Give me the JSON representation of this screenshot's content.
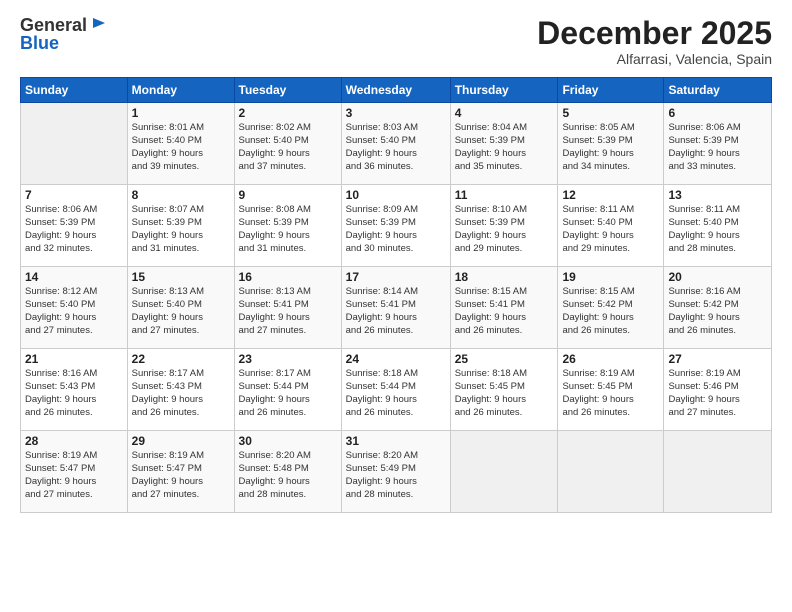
{
  "header": {
    "logo_general": "General",
    "logo_blue": "Blue",
    "month_title": "December 2025",
    "location": "Alfarrasi, Valencia, Spain"
  },
  "days_of_week": [
    "Sunday",
    "Monday",
    "Tuesday",
    "Wednesday",
    "Thursday",
    "Friday",
    "Saturday"
  ],
  "weeks": [
    [
      {
        "num": "",
        "info": ""
      },
      {
        "num": "1",
        "info": "Sunrise: 8:01 AM\nSunset: 5:40 PM\nDaylight: 9 hours\nand 39 minutes."
      },
      {
        "num": "2",
        "info": "Sunrise: 8:02 AM\nSunset: 5:40 PM\nDaylight: 9 hours\nand 37 minutes."
      },
      {
        "num": "3",
        "info": "Sunrise: 8:03 AM\nSunset: 5:40 PM\nDaylight: 9 hours\nand 36 minutes."
      },
      {
        "num": "4",
        "info": "Sunrise: 8:04 AM\nSunset: 5:39 PM\nDaylight: 9 hours\nand 35 minutes."
      },
      {
        "num": "5",
        "info": "Sunrise: 8:05 AM\nSunset: 5:39 PM\nDaylight: 9 hours\nand 34 minutes."
      },
      {
        "num": "6",
        "info": "Sunrise: 8:06 AM\nSunset: 5:39 PM\nDaylight: 9 hours\nand 33 minutes."
      }
    ],
    [
      {
        "num": "7",
        "info": "Sunrise: 8:06 AM\nSunset: 5:39 PM\nDaylight: 9 hours\nand 32 minutes."
      },
      {
        "num": "8",
        "info": "Sunrise: 8:07 AM\nSunset: 5:39 PM\nDaylight: 9 hours\nand 31 minutes."
      },
      {
        "num": "9",
        "info": "Sunrise: 8:08 AM\nSunset: 5:39 PM\nDaylight: 9 hours\nand 31 minutes."
      },
      {
        "num": "10",
        "info": "Sunrise: 8:09 AM\nSunset: 5:39 PM\nDaylight: 9 hours\nand 30 minutes."
      },
      {
        "num": "11",
        "info": "Sunrise: 8:10 AM\nSunset: 5:39 PM\nDaylight: 9 hours\nand 29 minutes."
      },
      {
        "num": "12",
        "info": "Sunrise: 8:11 AM\nSunset: 5:40 PM\nDaylight: 9 hours\nand 29 minutes."
      },
      {
        "num": "13",
        "info": "Sunrise: 8:11 AM\nSunset: 5:40 PM\nDaylight: 9 hours\nand 28 minutes."
      }
    ],
    [
      {
        "num": "14",
        "info": "Sunrise: 8:12 AM\nSunset: 5:40 PM\nDaylight: 9 hours\nand 27 minutes."
      },
      {
        "num": "15",
        "info": "Sunrise: 8:13 AM\nSunset: 5:40 PM\nDaylight: 9 hours\nand 27 minutes."
      },
      {
        "num": "16",
        "info": "Sunrise: 8:13 AM\nSunset: 5:41 PM\nDaylight: 9 hours\nand 27 minutes."
      },
      {
        "num": "17",
        "info": "Sunrise: 8:14 AM\nSunset: 5:41 PM\nDaylight: 9 hours\nand 26 minutes."
      },
      {
        "num": "18",
        "info": "Sunrise: 8:15 AM\nSunset: 5:41 PM\nDaylight: 9 hours\nand 26 minutes."
      },
      {
        "num": "19",
        "info": "Sunrise: 8:15 AM\nSunset: 5:42 PM\nDaylight: 9 hours\nand 26 minutes."
      },
      {
        "num": "20",
        "info": "Sunrise: 8:16 AM\nSunset: 5:42 PM\nDaylight: 9 hours\nand 26 minutes."
      }
    ],
    [
      {
        "num": "21",
        "info": "Sunrise: 8:16 AM\nSunset: 5:43 PM\nDaylight: 9 hours\nand 26 minutes."
      },
      {
        "num": "22",
        "info": "Sunrise: 8:17 AM\nSunset: 5:43 PM\nDaylight: 9 hours\nand 26 minutes."
      },
      {
        "num": "23",
        "info": "Sunrise: 8:17 AM\nSunset: 5:44 PM\nDaylight: 9 hours\nand 26 minutes."
      },
      {
        "num": "24",
        "info": "Sunrise: 8:18 AM\nSunset: 5:44 PM\nDaylight: 9 hours\nand 26 minutes."
      },
      {
        "num": "25",
        "info": "Sunrise: 8:18 AM\nSunset: 5:45 PM\nDaylight: 9 hours\nand 26 minutes."
      },
      {
        "num": "26",
        "info": "Sunrise: 8:19 AM\nSunset: 5:45 PM\nDaylight: 9 hours\nand 26 minutes."
      },
      {
        "num": "27",
        "info": "Sunrise: 8:19 AM\nSunset: 5:46 PM\nDaylight: 9 hours\nand 27 minutes."
      }
    ],
    [
      {
        "num": "28",
        "info": "Sunrise: 8:19 AM\nSunset: 5:47 PM\nDaylight: 9 hours\nand 27 minutes."
      },
      {
        "num": "29",
        "info": "Sunrise: 8:19 AM\nSunset: 5:47 PM\nDaylight: 9 hours\nand 27 minutes."
      },
      {
        "num": "30",
        "info": "Sunrise: 8:20 AM\nSunset: 5:48 PM\nDaylight: 9 hours\nand 28 minutes."
      },
      {
        "num": "31",
        "info": "Sunrise: 8:20 AM\nSunset: 5:49 PM\nDaylight: 9 hours\nand 28 minutes."
      },
      {
        "num": "",
        "info": ""
      },
      {
        "num": "",
        "info": ""
      },
      {
        "num": "",
        "info": ""
      }
    ]
  ]
}
